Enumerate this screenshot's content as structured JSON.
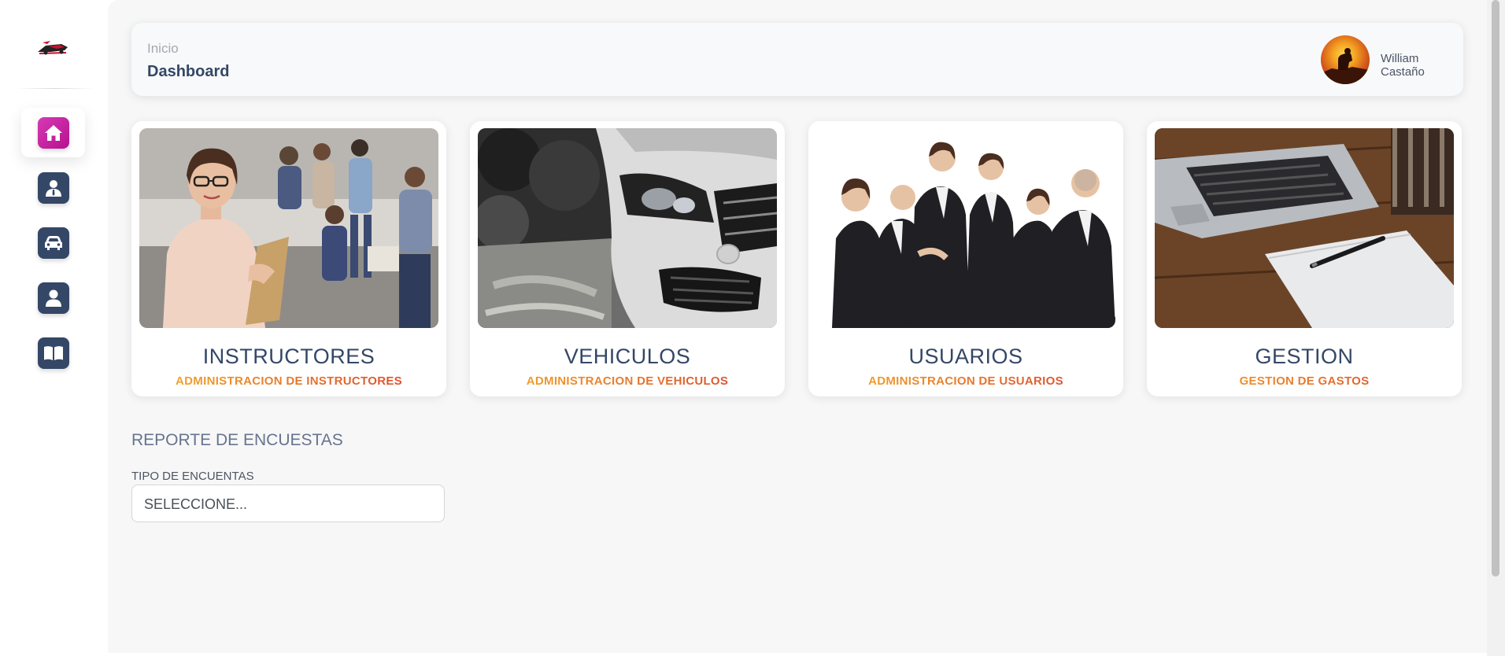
{
  "header": {
    "breadcrumb": "Inicio",
    "title": "Dashboard",
    "user_name": "William Castaño"
  },
  "sidebar": {
    "items": [
      {
        "icon": "home-icon",
        "active": true
      },
      {
        "icon": "instructor-icon",
        "active": false
      },
      {
        "icon": "car-icon",
        "active": false
      },
      {
        "icon": "user-icon",
        "active": false
      },
      {
        "icon": "book-icon",
        "active": false
      }
    ]
  },
  "cards": [
    {
      "title": "INSTRUCTORES",
      "subtitle": "ADMINISTRACION DE INSTRUCTORES"
    },
    {
      "title": "VEHICULOS",
      "subtitle": "ADMINISTRACION DE VEHICULOS"
    },
    {
      "title": "USUARIOS",
      "subtitle": "ADMINISTRACION DE USUARIOS"
    },
    {
      "title": "GESTION",
      "subtitle": "GESTION DE GASTOS"
    }
  ],
  "report": {
    "title": "REPORTE DE ENCUESTAS",
    "field_label": "TIPO DE ENCUENTAS",
    "select_value": "SELECCIONE..."
  },
  "colors": {
    "accent_pink": "#cb0c9f",
    "nav_dark": "#344767",
    "gradient_start": "#f5b12a",
    "gradient_end": "#d8402f"
  }
}
